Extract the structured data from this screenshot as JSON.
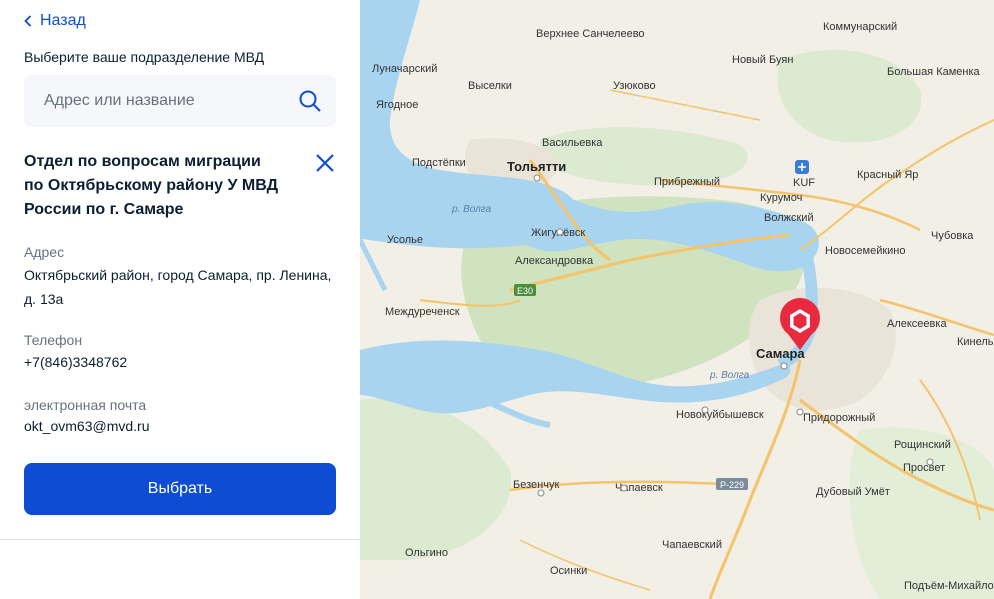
{
  "nav": {
    "back_label": "Назад"
  },
  "panel": {
    "subtitle": "Выберите ваше подразделение МВД",
    "search_placeholder": "Адрес или название",
    "office": {
      "title": "Отдел по вопросам миграции по Октябрьскому району У МВД России по г. Самаре",
      "address_label": "Адрес",
      "address": "Октябрьский район, город Самара, пр. Ленина, д. 13а",
      "phone_label": "Телефон",
      "phone": "+7(846)3348762",
      "email_label": "электронная почта",
      "email": "okt_ovm63@mvd.ru"
    },
    "select_button": "Выбрать"
  },
  "map": {
    "river_label": "р. Волга",
    "highways": [
      "E30",
      "Р-229"
    ],
    "airport_code": "KUF",
    "places": [
      "Верхнее Санчелеево",
      "Коммунарский",
      "Новый Буян",
      "Луначарский",
      "Выселки",
      "Узюково",
      "Большая Каменка",
      "Ягодное",
      "Подстёпки",
      "Тольятти",
      "Васильевка",
      "Прибрежный",
      "Курумоч",
      "Красный Яр",
      "Волжский",
      "Усолье",
      "Жигулёвск",
      "Новосемейкино",
      "Чубовка",
      "Александровка",
      "Междуреченск",
      "Алексеевка",
      "Самара",
      "Кинель",
      "Новокуйбышевск",
      "Придорожный",
      "Рощинский",
      "Просвет",
      "Безенчук",
      "Чапаевск",
      "Дубовый Умёт",
      "Чапаевский",
      "Ольгино",
      "Осинки",
      "Подъём-Михайловка"
    ]
  },
  "colors": {
    "accent": "#0d4cd3",
    "marker": "#e8293e",
    "water": "#a8d4f0",
    "forest": "#d4e7c5"
  }
}
